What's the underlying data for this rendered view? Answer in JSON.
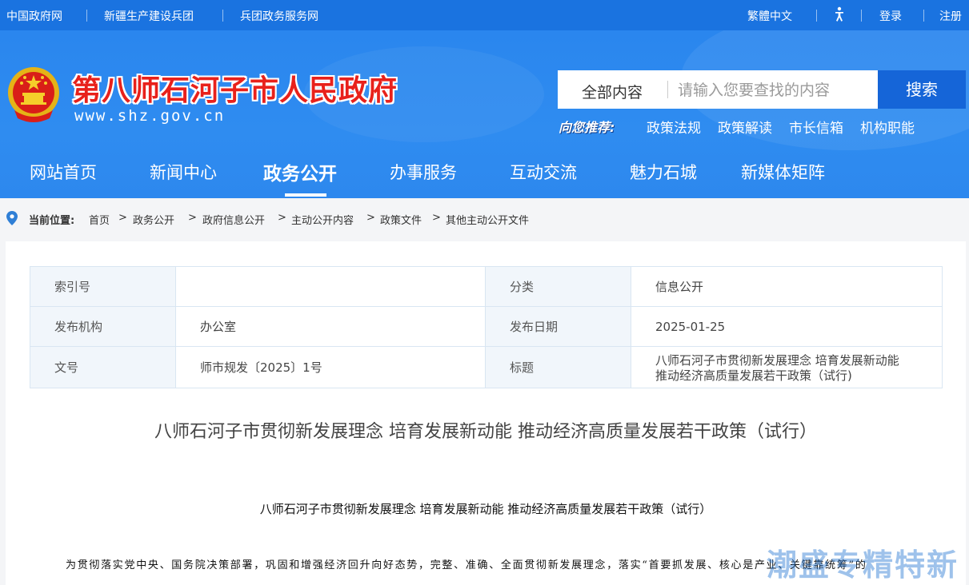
{
  "colors": {
    "brand_blue": "#1a73e0",
    "title_red": "#e8211b",
    "search_button": "#1565d8"
  },
  "topbar": {
    "links": [
      "中国政府网",
      "新疆生产建设兵团",
      "兵团政务服务网"
    ],
    "traditional": "繁體中文",
    "accessibility_icon": "accessibility-icon",
    "login": "登录",
    "register": "注册"
  },
  "header": {
    "emblem_icon": "national-emblem-icon",
    "title": "第八师石河子市人民政府",
    "url": "www.shz.gov.cn",
    "search": {
      "scope": "全部内容",
      "placeholder": "请输入您要查找的内容",
      "button": "搜索"
    },
    "recommend": {
      "label": "向您推荐:",
      "links": [
        "政策法规",
        "政策解读",
        "市长信箱",
        "机构职能"
      ]
    },
    "nav": [
      "网站首页",
      "新闻中心",
      "政务公开",
      "办事服务",
      "互动交流",
      "魅力石城",
      "新媒体矩阵"
    ],
    "nav_active": "政务公开"
  },
  "breadcrumb": {
    "icon": "location-pin-icon",
    "label": "当前位置:",
    "items": [
      "首页",
      "政务公开",
      "政府信息公开",
      "主动公开内容",
      "政策文件",
      "其他主动公开文件"
    ],
    "separator": ">"
  },
  "meta": {
    "index_label": "索引号",
    "index_value": "",
    "category_label": "分类",
    "category_value": "信息公开",
    "publisher_label": "发布机构",
    "publisher_value": "办公室",
    "date_label": "发布日期",
    "date_value": "2025-01-25",
    "docno_label": "文号",
    "docno_value": "师市规发〔2025〕1号",
    "title_label": "标题",
    "title_value_line1": "八师石河子市贯彻新发展理念 培育发展新动能",
    "title_value_line2": "推动经济高质量发展若干政策（试行)"
  },
  "article": {
    "title": "八师石河子市贯彻新发展理念 培育发展新动能 推动经济高质量发展若干政策（试行）",
    "subtitle": "八师石河子市贯彻新发展理念 培育发展新动能 推动经济高质量发展若干政策（试行）",
    "body_first_line": "为贯彻落实党中央、国务院决策部署，巩固和增强经济回升向好态势，完整、准确、全面贯彻新发展理念，落实“首要抓发展、核心是产业、关键靠统筹”的"
  },
  "watermark": "潮盛专精特新"
}
